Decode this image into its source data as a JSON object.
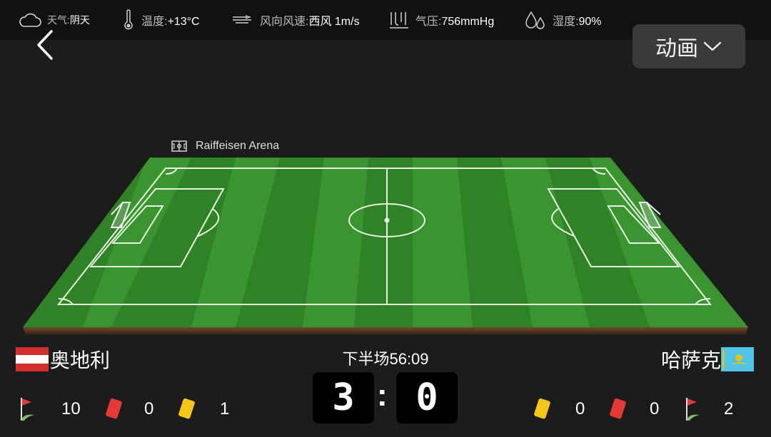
{
  "weather": {
    "condition_label": "天气:",
    "condition_value": "阴天",
    "temperature_label": "温度:",
    "temperature_value": "+13°C",
    "wind_label": "风向风速:",
    "wind_value": "西风 1m/s",
    "pressure_label": "气压:",
    "pressure_value": "756mmHg",
    "humidity_label": "湿度:",
    "humidity_value": "90%"
  },
  "header": {
    "animation_label": "动画"
  },
  "venue": {
    "name": "Raiffeisen Arena"
  },
  "match": {
    "period_time": "下半场56:09",
    "home_score": "3",
    "score_separator": ":",
    "away_score": "0"
  },
  "home_team": {
    "name": "奥地利",
    "corners": "10",
    "red_cards": "0",
    "yellow_cards": "1"
  },
  "away_team": {
    "name": "哈萨克",
    "yellow_cards": "0",
    "red_cards": "0",
    "corners": "2"
  },
  "colors": {
    "pitch_light": "#3f9b2f",
    "pitch_dark": "#2f7f24",
    "red_card": "#e53935",
    "yellow_card": "#f5c518",
    "austria_red": "#d32f2f",
    "kazakh_blue": "#4fc3e8"
  }
}
